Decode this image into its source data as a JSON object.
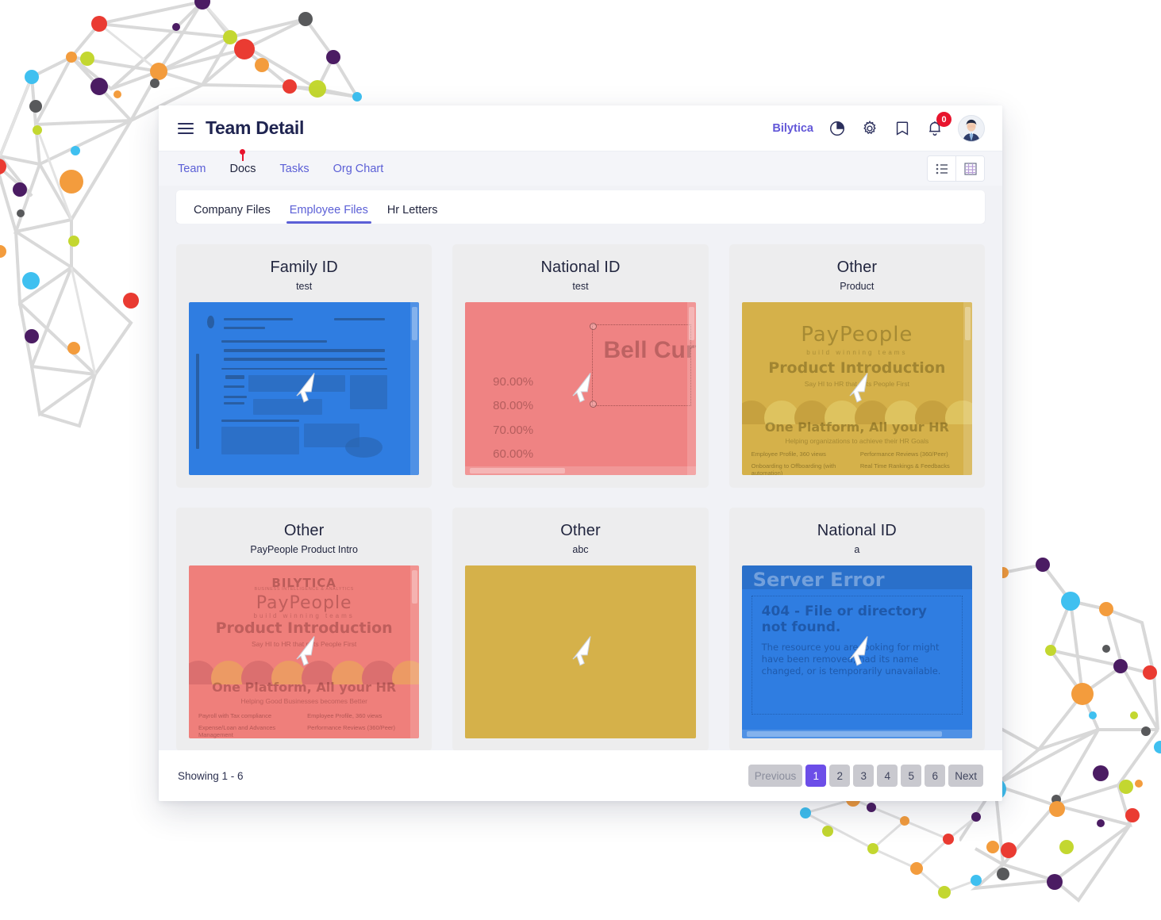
{
  "header": {
    "title": "Team Detail",
    "menu_icon": "hamburger-icon",
    "brand": "Bilytica",
    "icons": [
      {
        "name": "pie-chart-icon"
      },
      {
        "name": "gear-icon"
      },
      {
        "name": "bookmark-icon"
      },
      {
        "name": "bell-icon"
      }
    ],
    "notification_count": "0",
    "avatar_alt": "User avatar"
  },
  "subnav": {
    "links": [
      {
        "label": "Team",
        "active": false
      },
      {
        "label": "Docs",
        "active": true
      },
      {
        "label": "Tasks",
        "active": false
      },
      {
        "label": "Org Chart",
        "active": false
      }
    ],
    "view_buttons": [
      {
        "name": "list-view-button"
      },
      {
        "name": "grid-view-button"
      }
    ]
  },
  "tabs": [
    {
      "label": "Company Files",
      "active": false
    },
    {
      "label": "Employee Files",
      "active": true
    },
    {
      "label": "Hr Letters",
      "active": false
    }
  ],
  "documents": [
    {
      "title": "Family ID",
      "subtitle": "test",
      "thumb_kind": "bill",
      "tint": "#2f7de1"
    },
    {
      "title": "National ID",
      "subtitle": "test",
      "thumb_kind": "spreadsheet",
      "tint": "#ef8383",
      "sheet_title": "Bell Curv",
      "axis_labels": [
        "90.00%",
        "80.00%",
        "70.00%",
        "60.00%"
      ]
    },
    {
      "title": "Other",
      "subtitle": "Product",
      "thumb_kind": "slide",
      "tint": "#d5b14a",
      "slide": {
        "logo": "PayPeople",
        "tagline": "build winning teams",
        "heading": "Product Introduction",
        "subheading": "Say HI to HR that puts People First",
        "footer_heading": "One Platform, All your HR",
        "footer_sub": "Helping organizations to achieve their HR Goals",
        "bullets": [
          "Employee Profile, 360 views",
          "Performance Reviews (360/Peer)",
          "Onboarding to Offboarding (with automation)",
          "Real Time Rankings & Feedbacks"
        ]
      }
    },
    {
      "title": "Other",
      "subtitle": "PayPeople Product Intro",
      "thumb_kind": "slide-bilytica",
      "tint": "#ef7f7b",
      "slide": {
        "brand": "BILYTICA",
        "brand_sub": "BUSINESS INTELLIGENCE & ANALYTICS",
        "logo": "PayPeople",
        "tagline": "build winning teams",
        "heading": "Product Introduction",
        "subheading": "Say HI to HR that puts People First",
        "footer_heading": "One Platform, All your HR",
        "footer_sub": "Helping Good Businesses becomes Better",
        "bullets": [
          "Payroll with Tax compliance",
          "Employee Profile, 360 views",
          "Expense/Loan and Advances Management",
          "Performance Reviews (360/Peer)"
        ]
      }
    },
    {
      "title": "Other",
      "subtitle": "abc",
      "thumb_kind": "plain",
      "tint": "#d5b14a"
    },
    {
      "title": "National ID",
      "subtitle": "a",
      "thumb_kind": "error",
      "tint": "#2f7de1",
      "error": {
        "banner": "Server Error",
        "heading": "404 - File or directory not found.",
        "body": "The resource you are looking for might have been removed, had its name changed, or is temporarily unavailable."
      }
    }
  ],
  "footer": {
    "showing": "Showing 1 - 6",
    "pagination": {
      "previous": "Previous",
      "next": "Next",
      "pages": [
        "1",
        "2",
        "3",
        "4",
        "5",
        "6"
      ],
      "active_page": "1"
    }
  },
  "colors": {
    "accent_purple": "#5b5fd6",
    "pager_active": "#6c4ee8",
    "badge_red": "#e8142d",
    "title_navy": "#1f2450"
  }
}
